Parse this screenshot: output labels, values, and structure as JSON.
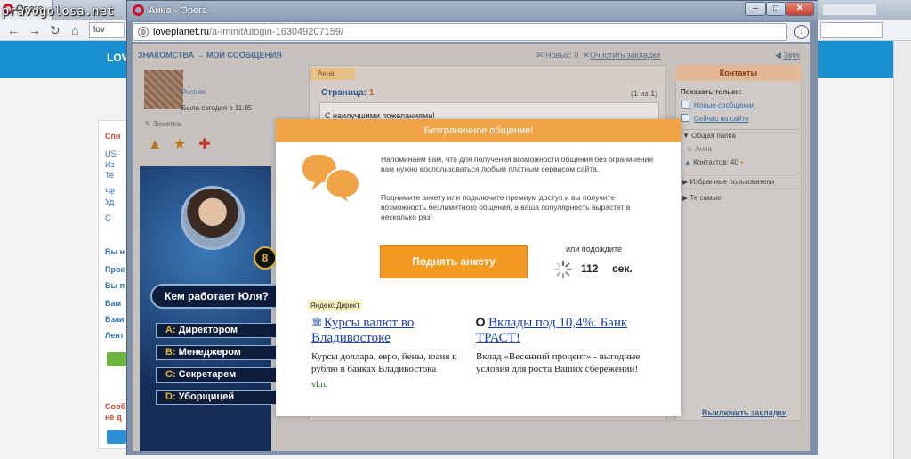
{
  "background_browser": {
    "tab_title": "Opera",
    "watermark": "pravogolosa.net",
    "url_fragment": "lov",
    "site_logo": "LOV",
    "left_column": [
      "Спи",
      "US",
      "Из",
      "Те",
      "Чё",
      "Уд",
      "С",
      "Вы н",
      "Прос",
      "Вы п",
      "Вам",
      "Взаи",
      "Лент",
      "Сооб",
      "не д"
    ]
  },
  "window": {
    "title": "Анна - Opera",
    "url_host": "loveplanet.ru",
    "url_path": "/a-iminit/ulogin-163049207159/"
  },
  "page": {
    "breadcrumb": "ЗНАКОМСТВА → МОИ СООБЩЕНИЯ",
    "new_count": "Новых: 0",
    "clear_bookmarks": "Очистить закладки",
    "sound": "Звук",
    "profile": {
      "city": "Россия,",
      "last_seen": "Была сегодня в 11:05",
      "note": "Заметка"
    },
    "game": {
      "number": "8",
      "question": "Кем работает Юля?",
      "answers": [
        {
          "letter": "A:",
          "text": "Директором"
        },
        {
          "letter": "B:",
          "text": "Менеджером"
        },
        {
          "letter": "C:",
          "text": "Секретарем"
        },
        {
          "letter": "D:",
          "text": "Уборщицей"
        }
      ]
    },
    "messages": {
      "tab": "Анна",
      "page_label": "Страница:",
      "page_num": "1",
      "page_count": "(1 из 1)",
      "greeting": "С наилучшими пожеланиями!"
    },
    "contacts": {
      "header": "Контакты",
      "show_only": "Показать только:",
      "filter_new": "Новые сообщения",
      "filter_online": "Сейчас на сайте",
      "folder_common": "Общая папка",
      "contact_anna": "Анна",
      "contacts_count": "Контактов: 40",
      "folder_favorites": "Избранные пользователи",
      "folder_those": "Те самые",
      "clear_bookmarks": "Выключить закладки"
    }
  },
  "modal": {
    "title": "Безграничное общение!",
    "text1": "Напоминаем вам, что для получения возможности общения без ограничений вам нужно воспользоваться любым платным сервисом сайта.",
    "text2": "Поднимите анкету или подключите премиум доступ и вы получите возможность безлимитного общения, а ваша популярность вырастет в несколько раз!",
    "raise_button": "Поднять анкету",
    "wait_label": "или подождите",
    "countdown": "112",
    "countdown_unit": "сек.",
    "accent_color": "#f39a22"
  },
  "ads": {
    "badge": "Яндекс.Директ",
    "items": [
      {
        "title": "Курсы валют во Владивостоке",
        "desc": "Курсы доллара, евро, йены, юаня к рублю в банках Владивостока",
        "domain": "vl.ru"
      },
      {
        "title": "Вклады под 10,4%. Банк ТРАСТ!",
        "desc": "Вклад «Весенний процент» - выгодные условия для роста Ваших сбережений!",
        "domain": ""
      }
    ]
  }
}
